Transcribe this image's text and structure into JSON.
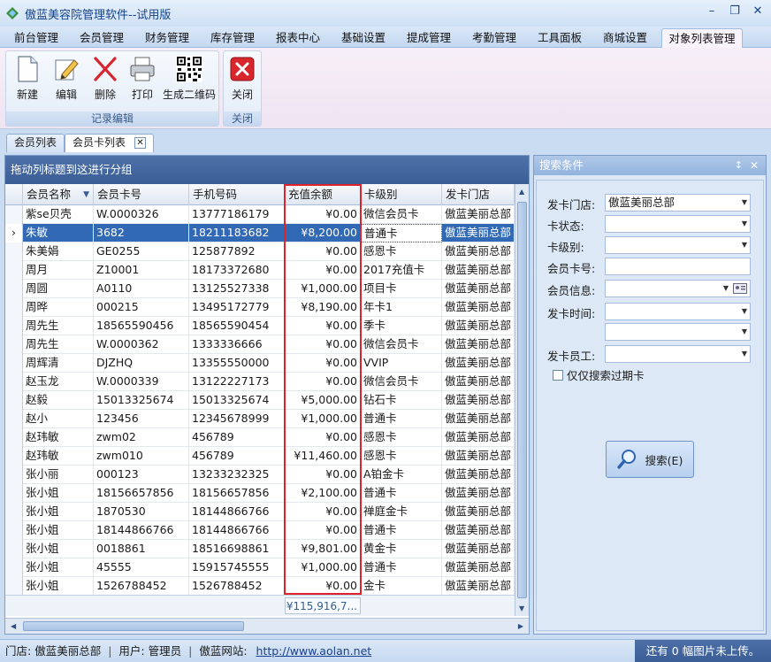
{
  "window": {
    "title": "傲蓝美容院管理软件--试用版",
    "minimize": "–",
    "restore": "❐",
    "close": "✕"
  },
  "menu": {
    "tabs": [
      "前台管理",
      "会员管理",
      "财务管理",
      "库存管理",
      "报表中心",
      "基础设置",
      "提成管理",
      "考勤管理",
      "工具面板",
      "商城设置",
      "对象列表管理"
    ],
    "active_index": 10
  },
  "ribbon": {
    "record_group_label": "记录编辑",
    "close_group_label": "关闭",
    "buttons": {
      "new": "新建",
      "edit": "编辑",
      "delete": "删除",
      "print": "打印",
      "qrcode": "生成二维码",
      "close": "关闭"
    }
  },
  "doc_tabs": {
    "tab1": "会员列表",
    "tab2": "会员卡列表",
    "close_glyph": "✕"
  },
  "grid": {
    "group_hint": "拖动列标题到这进行分组",
    "columns": [
      "会员名称",
      "会员卡号",
      "手机号码",
      "充值余额",
      "卡级别",
      "发卡门店"
    ],
    "sort_glyph": "▼",
    "selected_index": 1,
    "row_indicator": "›",
    "rows": [
      [
        "紫se贝壳",
        "W.0000326",
        "13777186179",
        "¥0.00",
        "微信会员卡",
        "傲蓝美丽总部"
      ],
      [
        "朱敏",
        "3682",
        "18211183682",
        "¥8,200.00",
        "普通卡",
        "傲蓝美丽总部"
      ],
      [
        "朱美娟",
        "GE0255",
        "125877892",
        "¥0.00",
        "感恩卡",
        "傲蓝美丽总部"
      ],
      [
        "周月",
        "Z10001",
        "18173372680",
        "¥0.00",
        "2017充值卡",
        "傲蓝美丽总部"
      ],
      [
        "周圆",
        "A0110",
        "13125527338",
        "¥1,000.00",
        "项目卡",
        "傲蓝美丽总部"
      ],
      [
        "周晔",
        "000215",
        "13495172779",
        "¥8,190.00",
        "年卡1",
        "傲蓝美丽总部"
      ],
      [
        "周先生",
        "18565590456",
        "18565590454",
        "¥0.00",
        "季卡",
        "傲蓝美丽总部"
      ],
      [
        "周先生",
        "W.0000362",
        "1333336666",
        "¥0.00",
        "微信会员卡",
        "傲蓝美丽总部"
      ],
      [
        "周辉清",
        "DJZHQ",
        "13355550000",
        "¥0.00",
        "VVIP",
        "傲蓝美丽总部"
      ],
      [
        "赵玉龙",
        "W.0000339",
        "13122227173",
        "¥0.00",
        "微信会员卡",
        "傲蓝美丽总部"
      ],
      [
        "赵毅",
        "15013325674",
        "15013325674",
        "¥5,000.00",
        "钻石卡",
        "傲蓝美丽总部"
      ],
      [
        "赵小",
        "123456",
        "12345678999",
        "¥1,000.00",
        "普通卡",
        "傲蓝美丽总部"
      ],
      [
        "赵玮敏",
        "zwm02",
        "456789",
        "¥0.00",
        "感恩卡",
        "傲蓝美丽总部"
      ],
      [
        "赵玮敏",
        "zwm010",
        "456789",
        "¥11,460.00",
        "感恩卡",
        "傲蓝美丽总部"
      ],
      [
        "张小丽",
        "000123",
        "13233232325",
        "¥0.00",
        "A铂金卡",
        "傲蓝美丽总部"
      ],
      [
        "张小姐",
        "18156657856",
        "18156657856",
        "¥2,100.00",
        "普通卡",
        "傲蓝美丽总部"
      ],
      [
        "张小姐",
        "1870530",
        "18144866766",
        "¥0.00",
        "禅庭金卡",
        "傲蓝美丽总部"
      ],
      [
        "张小姐",
        "18144866766",
        "18144866766",
        "¥0.00",
        "普通卡",
        "傲蓝美丽总部"
      ],
      [
        "张小姐",
        "0018861",
        "18516698861",
        "¥9,801.00",
        "黄金卡",
        "傲蓝美丽总部"
      ],
      [
        "张小姐",
        "45555",
        "15915745555",
        "¥1,000.00",
        "普通卡",
        "傲蓝美丽总部"
      ],
      [
        "张小姐",
        "1526788452",
        "1526788452",
        "¥0.00",
        "金卡",
        "傲蓝美丽总部"
      ]
    ],
    "footer_sum": "¥115,916,7..."
  },
  "search_panel": {
    "title": "搜索条件",
    "pin_glyph": "↕",
    "close_glyph": "✕",
    "labels": {
      "store": "发卡门店:",
      "card_status": "卡状态:",
      "card_level": "卡级别:",
      "card_no": "会员卡号:",
      "member_info": "会员信息:",
      "issue_time": "发卡时间:",
      "issue_staff": "发卡员工:"
    },
    "values": {
      "store": "傲蓝美丽总部"
    },
    "dropdown_glyph": "▼",
    "expired_only": "仅仅搜索过期卡",
    "search_button": "搜索(E)"
  },
  "status": {
    "store_label": "门店:",
    "store_value": "傲蓝美丽总部",
    "user_label": "用户:",
    "user_value": "管理员",
    "site_label": "傲蓝网站:",
    "site_url": "http://www.aolan.net",
    "sep": "|",
    "upload_info": "还有 0 幅图片未上传。"
  }
}
